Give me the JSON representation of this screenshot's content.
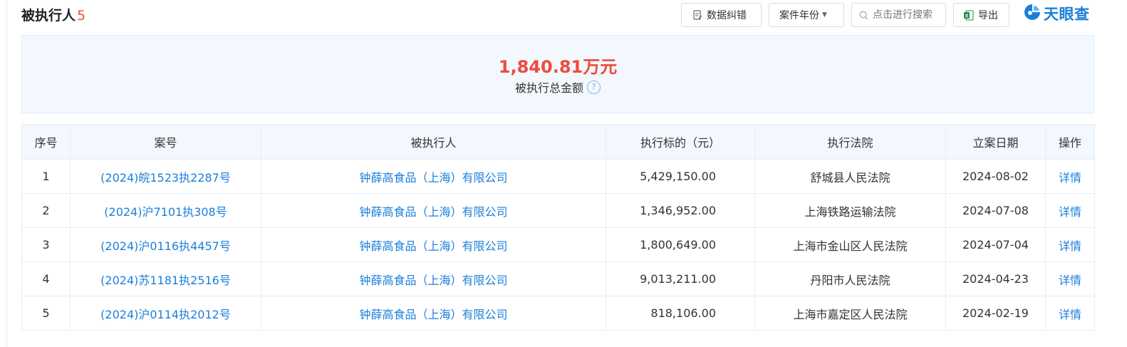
{
  "header": {
    "title": "被执行人",
    "count": "5",
    "correct_label": "数据纠错",
    "year_label": "案件年份",
    "search_placeholder": "点击进行搜索",
    "export_label": "导出",
    "logo_text": "天眼查"
  },
  "summary": {
    "amount": "1,840.81万元",
    "label": "被执行总金额",
    "help": "?"
  },
  "table": {
    "headers": [
      "序号",
      "案号",
      "被执行人",
      "执行标的（元）",
      "执行法院",
      "立案日期",
      "操作"
    ],
    "rows": [
      {
        "no": "1",
        "case": "(2024)皖1523执2287号",
        "party": "钟薛高食品（上海）有限公司",
        "amount": "5,429,150.00",
        "court": "舒城县人民法院",
        "date": "2024-08-02",
        "action": "详情"
      },
      {
        "no": "2",
        "case": "(2024)沪7101执308号",
        "party": "钟薛高食品（上海）有限公司",
        "amount": "1,346,952.00",
        "court": "上海铁路运输法院",
        "date": "2024-07-08",
        "action": "详情"
      },
      {
        "no": "3",
        "case": "(2024)沪0116执4457号",
        "party": "钟薛高食品（上海）有限公司",
        "amount": "1,800,649.00",
        "court": "上海市金山区人民法院",
        "date": "2024-07-04",
        "action": "详情"
      },
      {
        "no": "4",
        "case": "(2024)苏1181执2516号",
        "party": "钟薛高食品（上海）有限公司",
        "amount": "9,013,211.00",
        "court": "丹阳市人民法院",
        "date": "2024-04-23",
        "action": "详情"
      },
      {
        "no": "5",
        "case": "(2024)沪0114执2012号",
        "party": "钟薛高食品（上海）有限公司",
        "amount": "818,106.00",
        "court": "上海市嘉定区人民法院",
        "date": "2024-02-19",
        "action": "详情"
      }
    ]
  },
  "colors": {
    "accent": "#1a7fdc",
    "highlight": "#f04a3c",
    "summary_bg": "#f2f8fd"
  },
  "icons": [
    "edit-doc-icon",
    "caret-down-icon",
    "search-icon",
    "excel-icon",
    "tianyancha-logo-icon",
    "help-icon"
  ]
}
